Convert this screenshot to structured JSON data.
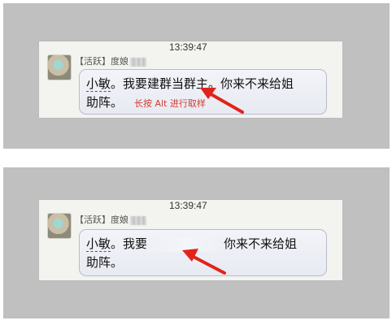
{
  "screens": [
    {
      "timestamp": "13:39:47",
      "sender": "【活跃】度娘",
      "mention": "小敏",
      "message_part1": "。我要建群当群主。你来不来给姐",
      "message_part2": "助阵。",
      "hint": "长按 Alt 进行取样"
    },
    {
      "timestamp": "13:39:47",
      "sender": "【活跃】度娘",
      "mention": "小敏",
      "message_part1": "。我要",
      "message_part1b": "你来不来给姐",
      "message_part2": "助阵。"
    }
  ],
  "colors": {
    "arrow": "#e0241b",
    "hint": "#d23a2f",
    "frame": "#c0c0c0"
  }
}
